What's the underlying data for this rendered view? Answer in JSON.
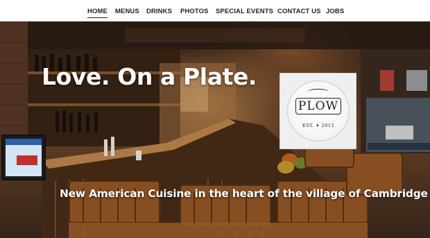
{
  "nav": {
    "items": [
      {
        "label": "HOME",
        "active": true
      },
      {
        "label": "MENUS",
        "active": false
      },
      {
        "label": "DRINKS",
        "active": false
      },
      {
        "label": "PHOTOS",
        "active": false
      },
      {
        "label": "SPECIAL EVENTS",
        "active": false
      },
      {
        "label": "CONTACT US",
        "active": false
      },
      {
        "label": "JOBS",
        "active": false
      }
    ]
  },
  "hero": {
    "title": "Love. On a Plate.",
    "subtitle": "New American Cuisine in the heart of the village of Cambridge"
  },
  "logo": {
    "name": "PLOW",
    "est": "EST. ✦ 2015"
  },
  "colors": {
    "nav_text": "#222222",
    "hero_text": "#ffffff",
    "wood_dark": "#3a271b",
    "wood_warm": "#6a4428"
  }
}
